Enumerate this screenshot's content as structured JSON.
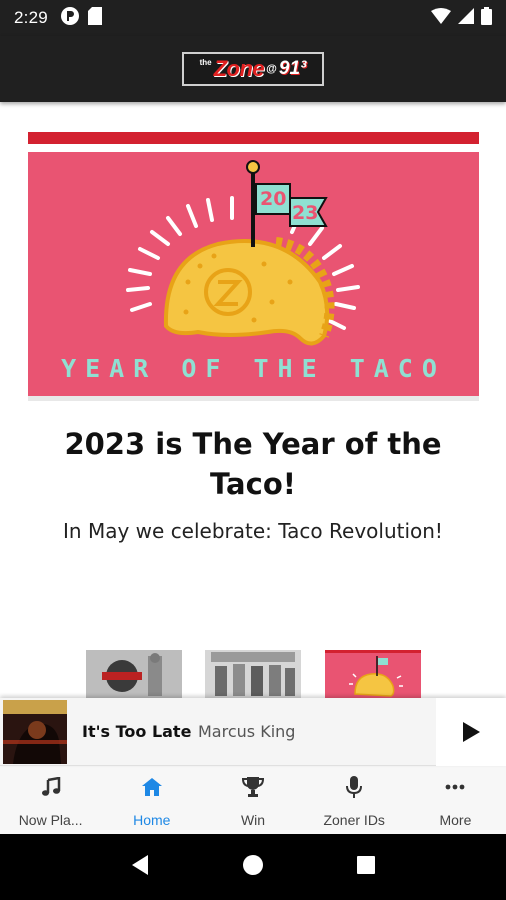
{
  "status_bar": {
    "time": "2:29",
    "icons_left": [
      "app-notification-icon",
      "sd-card-icon"
    ],
    "icons_right": [
      "wifi-icon",
      "cell-signal-icon",
      "battery-icon"
    ]
  },
  "app_bar": {
    "logo": {
      "the": "the",
      "zone": "Zone",
      "at": "@",
      "freq": "91³"
    }
  },
  "hero": {
    "flag_top": "20",
    "flag_bottom": "23",
    "caption": "YEAR OF THE TACO"
  },
  "article": {
    "title": "2023 is The Year of the Taco!",
    "subtitle": "In May we celebrate: Taco Revolution!"
  },
  "thumbnails": [
    "thumb-1",
    "thumb-2",
    "thumb-3"
  ],
  "player": {
    "title": "It's Too Late",
    "artist": "Marcus King"
  },
  "bottom_nav": {
    "items": [
      {
        "label": "Now Pla...",
        "icon": "music-note-icon",
        "active": false
      },
      {
        "label": "Home",
        "icon": "home-icon",
        "active": true
      },
      {
        "label": "Win",
        "icon": "trophy-icon",
        "active": false
      },
      {
        "label": "Zoner IDs",
        "icon": "microphone-icon",
        "active": false
      },
      {
        "label": "More",
        "icon": "more-dots-icon",
        "active": false
      }
    ]
  },
  "colors": {
    "app_bar": "#202020",
    "hero_pink": "#e95472",
    "accent_teal": "#8fe0d2",
    "taco_yellow": "#f5c542",
    "active_blue": "#1e88e5"
  }
}
